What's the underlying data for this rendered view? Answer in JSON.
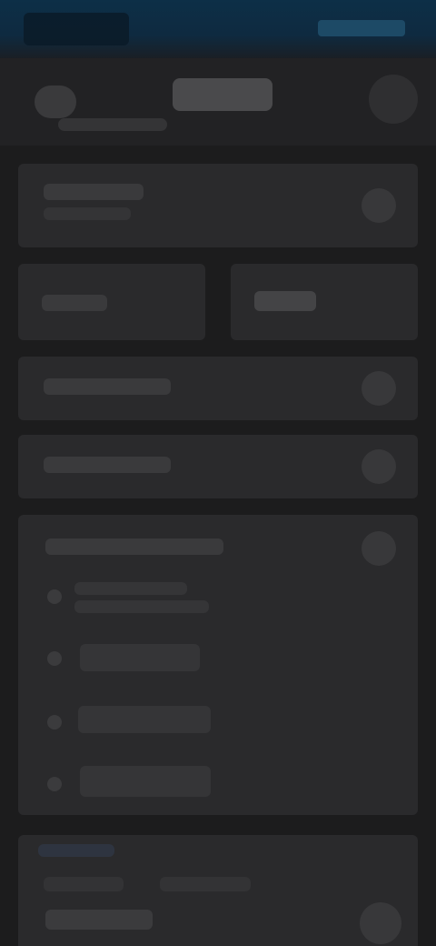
{
  "status_bar": {
    "time": "",
    "indicators": ""
  },
  "header": {
    "title": "",
    "subtitle": "",
    "action_icon": "options-icon"
  },
  "cards": {
    "top_card": {
      "label": "",
      "icon": "chevron-icon"
    },
    "split_left": {
      "label": ""
    },
    "split_right": {
      "label": ""
    },
    "row_one": {
      "label": "",
      "icon": "chevron-icon"
    },
    "row_two": {
      "label": "",
      "icon": "chevron-icon"
    },
    "expanded": {
      "label": "",
      "icon": "chevron-icon",
      "items": [
        {
          "label": ""
        },
        {
          "label": ""
        },
        {
          "label": ""
        },
        {
          "label": ""
        }
      ]
    }
  },
  "bottom_section": {
    "title": "",
    "left_label": "",
    "right_label": "",
    "value": ""
  },
  "colors": {
    "background": "#1c1c1d",
    "card": "#2a2a2c",
    "accent": "#0d2f47"
  }
}
